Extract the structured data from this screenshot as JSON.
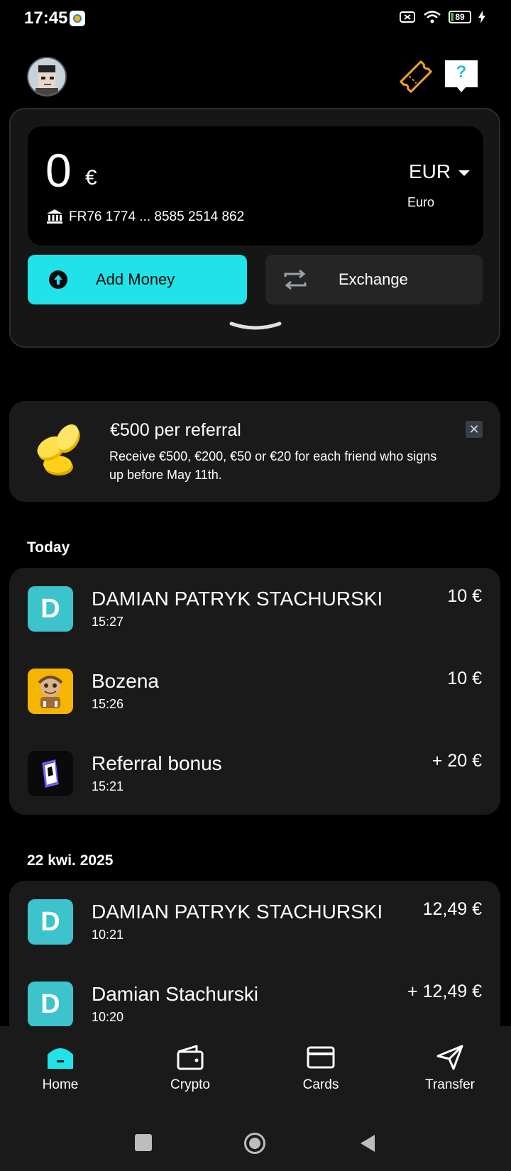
{
  "status_bar": {
    "time": "17:45",
    "battery": "89"
  },
  "colors": {
    "accent": "#1fe3e8",
    "ticket": "#f0a030",
    "help": "#22c6c6",
    "card": "#1a1a1a"
  },
  "header": {
    "avatar_icon": "pixel-avatar",
    "ticket_icon": "ticket-icon",
    "help_icon": "help-bubble-icon",
    "help_text": "?"
  },
  "account": {
    "amount": "0",
    "currency_symbol": "€",
    "iban": "FR76 1774 ... 8585 2514 862",
    "currency_code": "EUR",
    "currency_name": "Euro"
  },
  "actions": {
    "add_money": "Add Money",
    "exchange": "Exchange"
  },
  "promo": {
    "title": "€500 per referral",
    "body": "Receive €500, €200, €50 or €20 for each friend who signs up before May 11th.",
    "close": "✕"
  },
  "sections": [
    {
      "label": "Today",
      "transactions": [
        {
          "icon": "D",
          "name": "DAMIAN PATRYK STACHURSKI",
          "time": "15:27",
          "amount": "10 €"
        },
        {
          "icon": "bozena-avatar",
          "name": "Bozena",
          "time": "15:26",
          "amount": "10 €"
        },
        {
          "icon": "referral-bonus-logo",
          "name": "Referral bonus",
          "time": "15:21",
          "amount": "+ 20 €"
        }
      ]
    },
    {
      "label": "22 kwi. 2025",
      "transactions": [
        {
          "icon": "D",
          "name": "DAMIAN PATRYK STACHURSKI",
          "time": "10:21",
          "amount": "12,49 €"
        },
        {
          "icon": "D",
          "name": "Damian Stachurski",
          "time": "10:20",
          "amount": "+ 12,49 €"
        }
      ]
    }
  ],
  "nav": {
    "home": "Home",
    "crypto": "Crypto",
    "cards": "Cards",
    "transfer": "Transfer"
  }
}
